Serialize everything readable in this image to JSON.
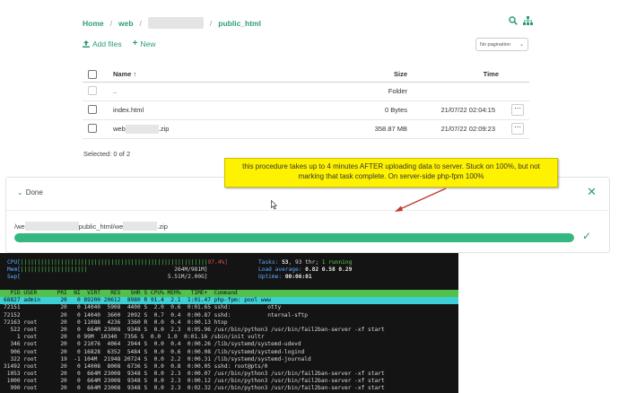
{
  "breadcrumb": {
    "home": "Home",
    "sep": "/",
    "web": "web",
    "public_html": "public_html"
  },
  "toolbar": {
    "add_files": "Add files",
    "new": "New",
    "pagination": "No pagination"
  },
  "table": {
    "headers": {
      "name": "Name",
      "size": "Size",
      "time": "Time"
    },
    "rows": [
      {
        "name": "..",
        "size": "Folder",
        "time": ""
      },
      {
        "name": "index.html",
        "size": "0 Bytes",
        "time": "21/07/22 02:04:15"
      },
      {
        "name_prefix": "web",
        "name_suffix": ".zip",
        "size": "358.87 MB",
        "time": "21/07/22 02:09:23"
      }
    ],
    "selected": "Selected: 0 of 2"
  },
  "upload": {
    "done": "Done",
    "path_prefix": "/we",
    "path_mid": "public_html/we",
    "path_suffix": ".zip",
    "progress": 1.0
  },
  "annotation": {
    "text": "this procedure takes up to 4 minutes AFTER uploading data to server. Stuck on 100%, but not marking that task complete. On server-side php-fpm 100%"
  },
  "htop": {
    "cpu_label": "CPU[",
    "cpu_value": "97.4%]",
    "mem_label": "Mem[",
    "mem_value": "264M/981M]",
    "swp_label": "Swp[",
    "swp_value": "5.51M/2.00G]",
    "tasks_label": "Tasks: ",
    "tasks_value": "53",
    "thr_text": ", 93 thr; ",
    "running": "1 running",
    "load_label": "Load average: ",
    "load_value": "0.82 0.58 0.29",
    "uptime_label": "Uptime: ",
    "uptime_value": "00:06:01",
    "header": "  PID USER      PRI  NI  VIRT   RES   SHR S CPU% MEM%   TIME+  Command",
    "rows": [
      "68827 admin      20   0 89200 20612  8980 R 91.4  2.1  1:01.47 php-fpm: pool www",
      "72151            20   0 14040  5908  4400 S  2.0  0.6  0:01.65 sshd:           otty",
      "72152            20   0 14040  3600  2092 S  0.7  0.4  0:00.87 sshd:           nternal-sftp",
      "72163 root       20   0 11088  4236  3360 R  0.0  0.4  0:00.13 htop",
      "  522 root       20   0  664M 23008  9348 S  0.0  2.3  0:05.96 /usr/bin/python3 /usr/bin/fail2ban-server -xf start",
      "    1 root       20   0 99M  10340  7356 S  0.0  1.0  0:01.16 /sbin/init vultr",
      "  346 root       20   0 21076  4064  2944 S  0.0  0.4  0:00.26 /lib/systemd/systemd-udevd",
      "  906 root       20   0 16828  6352  5484 S  0.0  0.6  0:00.08 /lib/systemd/systemd-logind",
      "  322 root       19  -1 104M  21948 20724 S  0.0  2.2  0:00.31 /lib/systemd/systemd-journald",
      "31492 root       20   0 14008  8008  6736 S  0.0  0.8  0:00.05 sshd: root@pts/0",
      " 1053 root       20   0  664M 23008  9348 S  0.0  2.3  0:00.07 /usr/bin/python3 /usr/bin/fail2ban-server -xf start",
      " 1000 root       20   0  664M 23008  9348 S  0.0  2.3  0:00.12 /usr/bin/python3 /usr/bin/fail2ban-server -xf start",
      "  990 root       20   0  664M 23008  9348 S  0.0  2.3  0:02.32 /usr/bin/python3 /usr/bin/fail2ban-server -xf start"
    ]
  },
  "colors": {
    "accent": "#2e9d73",
    "progress": "#35b781",
    "callout": "#fff200",
    "terminal_bg": "#141414"
  }
}
